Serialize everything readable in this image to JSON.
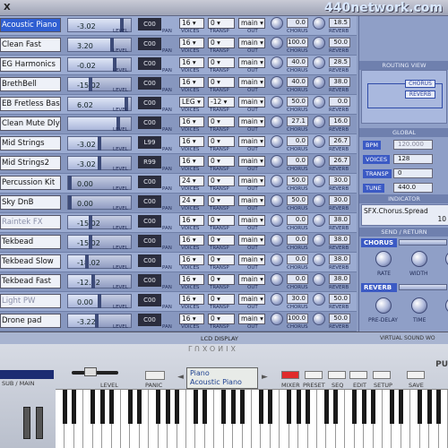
{
  "app": {
    "title": "X",
    "watermark": "440network.com"
  },
  "mixer": {
    "labels": {
      "level": "LEVEL",
      "pan": "PAN",
      "voices": "VOICES",
      "transp": "TRANSP",
      "out": "OUT",
      "chorus": "CHORUS",
      "reverb": "REVERB"
    },
    "rows": [
      {
        "name": "Acoustic Piano",
        "level": "-3.02",
        "level_fraction": 0.85,
        "pan": "C00",
        "voices": "16",
        "transp": "0",
        "out": "main",
        "chorus": "0.0",
        "reverb": "18.5",
        "selected": true
      },
      {
        "name": "Clean Fast",
        "level": "3.20",
        "level_fraction": 0.7,
        "pan": "C00",
        "voices": "16",
        "transp": "0",
        "out": "main",
        "chorus": "100.0",
        "reverb": "50.0"
      },
      {
        "name": "EG Harmonics",
        "level": "-0.02",
        "level_fraction": 0.74,
        "pan": "C00",
        "voices": "16",
        "transp": "0",
        "out": "main",
        "chorus": "40.0",
        "reverb": "28.5"
      },
      {
        "name": "BrethBell",
        "level": "-15.02",
        "level_fraction": 0.35,
        "pan": "C00",
        "voices": "16",
        "transp": "0",
        "out": "main",
        "chorus": "40.0",
        "reverb": "38.0"
      },
      {
        "name": "EB Fretless Bass",
        "level": "6.02",
        "level_fraction": 0.93,
        "pan": "C00",
        "voices": "LEG",
        "transp": "-12",
        "out": "main",
        "chorus": "50.0",
        "reverb": "0.0"
      },
      {
        "name": "Clean Mute Dly",
        "level": "",
        "level_fraction": 0.8,
        "pan": "C00",
        "voices": "16",
        "transp": "0",
        "out": "main",
        "chorus": "27.1",
        "reverb": "16.0"
      },
      {
        "name": "Mid Strings",
        "level": "-3.02",
        "level_fraction": 0.5,
        "pan": "L99",
        "voices": "16",
        "transp": "0",
        "out": "main",
        "chorus": "0.0",
        "reverb": "26.7"
      },
      {
        "name": "Mid Strings2",
        "level": "-3.02",
        "level_fraction": 0.5,
        "pan": "R99",
        "voices": "16",
        "transp": "0",
        "out": "main",
        "chorus": "0.0",
        "reverb": "26.7"
      },
      {
        "name": "Percussion Kit",
        "level": "0.00",
        "level_fraction": 0.0,
        "pan": "C00",
        "voices": "24",
        "transp": "0",
        "out": "main",
        "chorus": "50.0",
        "reverb": "30.0"
      },
      {
        "name": "Sky DnB",
        "level": "0.00",
        "level_fraction": 0.0,
        "pan": "C00",
        "voices": "24",
        "transp": "0",
        "out": "main",
        "chorus": "50.0",
        "reverb": "30.0"
      },
      {
        "name": "Raintek FX",
        "level": "-15.02",
        "level_fraction": 0.35,
        "pan": "C00",
        "voices": "16",
        "transp": "0",
        "out": "main",
        "chorus": "0.0",
        "reverb": "38.0",
        "dim": true
      },
      {
        "name": "Tekbead",
        "level": "-15.02",
        "level_fraction": 0.35,
        "pan": "C00",
        "voices": "16",
        "transp": "0",
        "out": "main",
        "chorus": "0.0",
        "reverb": "38.0"
      },
      {
        "name": "Tekbead Slow",
        "level": "-18.02",
        "level_fraction": 0.3,
        "pan": "C00",
        "voices": "16",
        "transp": "0",
        "out": "main",
        "chorus": "0.0",
        "reverb": "38.0"
      },
      {
        "name": "Tekbead Fast",
        "level": "-12.02",
        "level_fraction": 0.4,
        "pan": "C00",
        "voices": "16",
        "transp": "0",
        "out": "main",
        "chorus": "0.0",
        "reverb": "38.0"
      },
      {
        "name": "Light PW",
        "level": "0.00",
        "level_fraction": 0.5,
        "pan": "C00",
        "voices": "16",
        "transp": "0",
        "out": "main",
        "chorus": "30.0",
        "reverb": "50.0",
        "dim": true
      },
      {
        "name": "Drone pad",
        "level": "-3.22",
        "level_fraction": 0.45,
        "pan": "C00",
        "voices": "16",
        "transp": "0",
        "out": "main",
        "chorus": "100.0",
        "reverb": "50.0"
      }
    ]
  },
  "right": {
    "routing_title": "ROUTING VIEW",
    "routing_chorus": "CHORUS",
    "routing_reverb": "REVERB",
    "global_title": "GLOBAL",
    "bpm_label": "BPM",
    "bpm": "120.000",
    "voices_label": "VOICES",
    "voices": "128",
    "transp_label": "TRANSP",
    "transp": "0",
    "tune_label": "TUNE",
    "tune": "440.0",
    "indicator_title": "INDICATOR",
    "indicator_text": "SFX.Chorus.Spread",
    "indicator_value": "10",
    "sendreturn_title": "SEND / RETURN",
    "chorus_label": "CHORUS",
    "rate": "RATE",
    "width": "WIDTH",
    "reverb_label": "REVERB",
    "predelay": "PRE-DELAY",
    "time": "TIME"
  },
  "bottom": {
    "lcd_label": "LCD DISPLAY",
    "virtual_label": "VIRTUAL SOUND WO",
    "logo": "LUXONIX",
    "sub_main": "SUB / MAIN",
    "level": "LEVEL",
    "panic": "PANIC",
    "lcd_line1": "Piano",
    "lcd_line2": "Acoustic Piano",
    "mixer": "MIXER",
    "preset": "PRESET",
    "seq": "SEQ",
    "edit": "EDIT",
    "setup": "SETUP",
    "save": "SAVE",
    "brand": "PU"
  }
}
